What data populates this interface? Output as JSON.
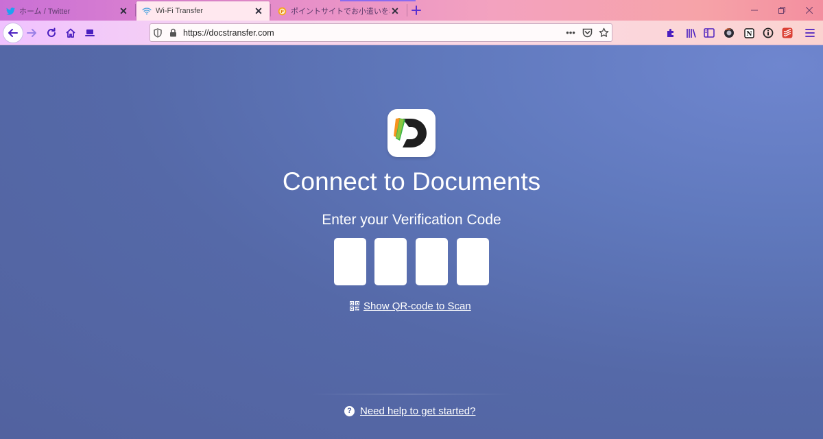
{
  "tabs": [
    {
      "title": "ホーム / Twitter",
      "favicon": "twitter-icon",
      "color": "#1da1f2"
    },
    {
      "title": "Wi-Fi Transfer",
      "favicon": "wifi-icon",
      "color": "#4aa3df",
      "active": true
    },
    {
      "title": "ポイントサイトでお小遣いを稼ぐな",
      "favicon": "point-site-icon",
      "color": "#f5a623"
    }
  ],
  "toolbar": {
    "url": "https://docstransfer.com",
    "page_actions": "•••"
  },
  "extensions": [
    "extensions-icon",
    "library-icon",
    "sidebar-icon",
    "firefox-monitor-icon",
    "notion-icon",
    "info-icon",
    "todoist-icon",
    "menu-icon"
  ],
  "page": {
    "heading": "Connect to Documents",
    "subheading": "Enter your Verification Code",
    "code_digits": [
      "",
      "",
      "",
      ""
    ],
    "qr_link": "Show QR-code to Scan",
    "help_link": "Need help to get started?"
  },
  "colors": {
    "page_bg": "#5a6fa8",
    "accent": "#4a1fbf",
    "logo_orange": "#f7931e",
    "logo_green": "#3cb54a",
    "logo_dark": "#1f1f1f"
  }
}
